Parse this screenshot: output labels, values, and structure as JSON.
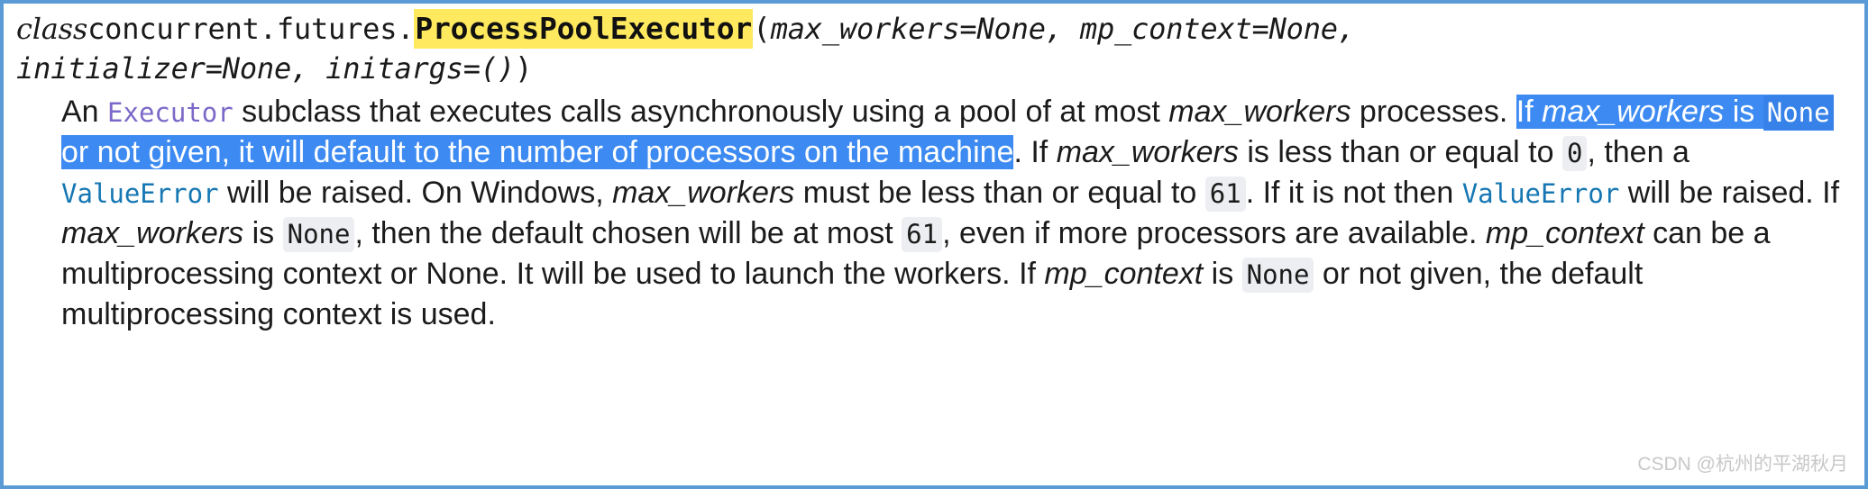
{
  "signature": {
    "keyword": "class",
    "module_path": "concurrent.futures.",
    "class_name": "ProcessPoolExecutor",
    "open_paren": "(",
    "params_line1": "max_workers=None, mp_context=None,",
    "params_line2": "initializer=None, initargs=()",
    "close_paren": ")",
    "highlight_color": "#ffe95e"
  },
  "description": {
    "s1": "An ",
    "ref_executor": "Executor",
    "s2": " subclass that executes calls asynchronously using a pool of at most ",
    "em_max_workers_1": "max_workers",
    "s3": " processes. ",
    "sel_s1": "If ",
    "sel_em_max_workers": "max_workers",
    "sel_s2": " is ",
    "sel_code_none": "None",
    "sel_s3": " or not given, it will default to the number of processors on the machine",
    "s4": ". If ",
    "em_max_workers_2": "max_workers",
    "s5": " is less than or equal to ",
    "code_zero": "0",
    "s6": ", then a ",
    "ref_valueerror_1": "ValueError",
    "s7": " will be raised. On Windows, ",
    "em_max_workers_3": "max_workers",
    "s8": " must be less than or equal to ",
    "code_61_1": "61",
    "s9": ". If it is not then ",
    "ref_valueerror_2": "ValueError",
    "s10": " will be raised. If ",
    "em_max_workers_4": "max_workers",
    "s11": " is ",
    "code_none_2": "None",
    "s12": ", then the default chosen will be at most ",
    "code_61_2": "61",
    "s13": ", even if more processors are available. ",
    "em_mp_context_1": "mp_context",
    "s14": " can be a multiprocessing context or None. It will be used to launch the workers. If ",
    "em_mp_context_2": "mp_context",
    "s15": " is ",
    "code_none_3": "None",
    "s16": " or not given, the default multiprocessing context is used."
  },
  "selection": {
    "color": "#3d8bf2",
    "code_color": "#3782e8",
    "text_color": "#ffffff"
  },
  "link_colors": {
    "executor": "#7b68c8",
    "valueerror": "#1677b3"
  },
  "watermark": {
    "text": "CSDN @杭州的平湖秋月"
  },
  "frame": {
    "border_color": "#5b9bd5"
  }
}
